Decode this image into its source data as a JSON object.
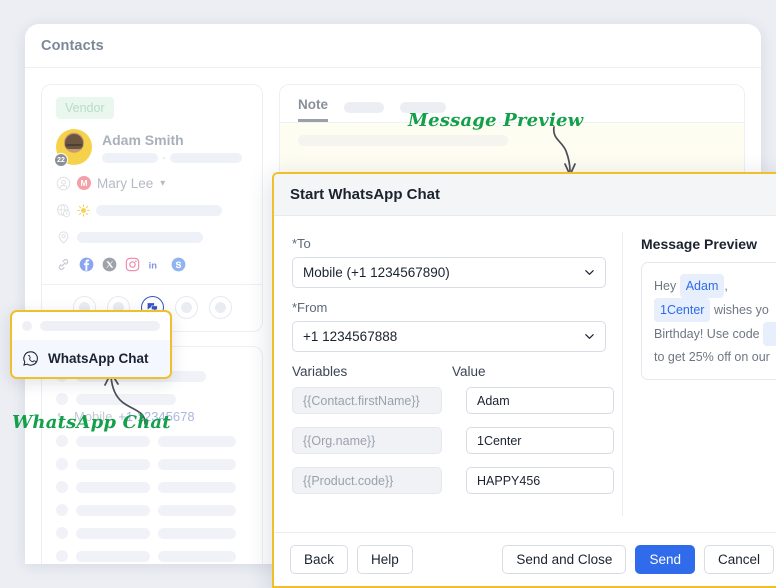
{
  "app": {
    "header_title": "Contacts"
  },
  "contact_card": {
    "badge": "Vendor",
    "avatar_badge": "22",
    "name": "Adam Smith",
    "owner_initial": "M",
    "owner_name": "Mary Lee",
    "social_icons": [
      "link-icon",
      "facebook-icon",
      "x-icon",
      "instagram-icon",
      "linkedin-icon",
      "skype-icon"
    ],
    "action_buttons": [
      "action-1",
      "action-2",
      "chat-action",
      "action-4",
      "action-5"
    ],
    "active_action_index": 2
  },
  "contact_card_2": {
    "mobile_label": "Mobile",
    "mobile_number": "+1 12345678"
  },
  "note_card": {
    "tab_label": "Note"
  },
  "wa_popup": {
    "item_label": "WhatsApp Chat",
    "icon": "whatsapp-icon"
  },
  "annotations": {
    "message_preview": "Message Preview",
    "whatsapp_chat": "WhatsApp Chat"
  },
  "modal": {
    "title": "Start WhatsApp Chat",
    "to": {
      "label": "*To",
      "value": "Mobile (+1 1234567890)"
    },
    "from": {
      "label": "*From",
      "value": "+1 1234567888"
    },
    "variables_header": {
      "key_col": "Variables",
      "value_col": "Value"
    },
    "variables": [
      {
        "key": "{{Contact.firstName}}",
        "value": "Adam"
      },
      {
        "key": "{{Org.name}}",
        "value": "1Center"
      },
      {
        "key": "{{Product.code}}",
        "value": "HAPPY456"
      }
    ],
    "preview": {
      "title": "Message Preview",
      "line1_pre": "Hey",
      "line1_chip": "Adam",
      "line1_post": ",",
      "line2_chip": "1Center",
      "line2_post": "wishes yo",
      "line3": "Birthday! Use code",
      "line4": "to get 25% off on our"
    },
    "buttons": {
      "back": "Back",
      "help": "Help",
      "send_and_close": "Send and Close",
      "send": "Send",
      "cancel": "Cancel"
    }
  },
  "colors": {
    "accent_blue": "#2f6bea",
    "highlight_yellow": "#f0c02a",
    "annotation_green": "#14a04a"
  }
}
